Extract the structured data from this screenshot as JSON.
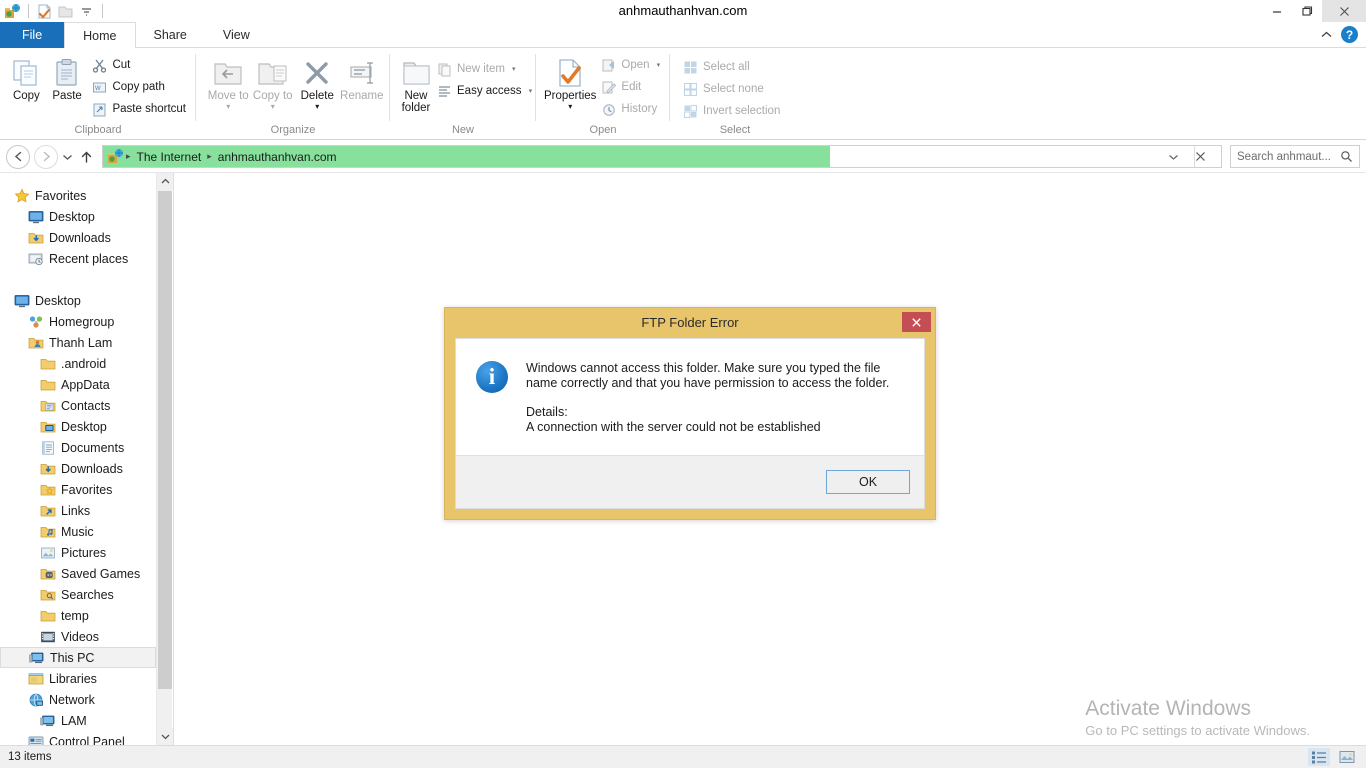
{
  "window": {
    "title": "anhmauthanhvan.com",
    "quick_access": [
      "ftp-folder-icon",
      "properties-icon",
      "folder-icon",
      "customize-dropdown-icon"
    ],
    "controls": {
      "minimize": "–",
      "maximize": "❐",
      "close": "✕"
    }
  },
  "ribbon": {
    "tabs": [
      {
        "label": "File",
        "state": "file"
      },
      {
        "label": "Home",
        "state": "active"
      },
      {
        "label": "Share",
        "state": "normal"
      },
      {
        "label": "View",
        "state": "normal"
      }
    ],
    "collapse_icon": "chevron-up-icon",
    "help_icon": "help-icon",
    "help_glyph": "?",
    "groups": [
      {
        "label": "Clipboard",
        "big": [
          {
            "label": "Copy",
            "icon": "copy-icon",
            "disabled": false
          },
          {
            "label": "Paste",
            "icon": "paste-icon",
            "disabled": false
          }
        ],
        "small": [
          {
            "label": "Cut",
            "icon": "cut-icon",
            "disabled": false
          },
          {
            "label": "Copy path",
            "icon": "copy-path-icon",
            "disabled": false
          },
          {
            "label": "Paste shortcut",
            "icon": "paste-shortcut-icon",
            "disabled": false
          }
        ]
      },
      {
        "label": "Organize",
        "big": [
          {
            "label": "Move to",
            "icon": "move-to-icon",
            "disabled": true,
            "dropdown": true
          },
          {
            "label": "Copy to",
            "icon": "copy-to-icon",
            "disabled": true,
            "dropdown": true
          },
          {
            "label": "Delete",
            "icon": "delete-icon",
            "disabled": false,
            "dropdown": true
          },
          {
            "label": "Rename",
            "icon": "rename-icon",
            "disabled": true
          }
        ],
        "small": []
      },
      {
        "label": "New",
        "big": [
          {
            "label": "New folder",
            "icon": "new-folder-icon",
            "disabled": false
          }
        ],
        "small": [
          {
            "label": "New item",
            "icon": "new-item-icon",
            "disabled": true,
            "dropdown": true
          },
          {
            "label": "Easy access",
            "icon": "easy-access-icon",
            "disabled": false,
            "dropdown": true
          }
        ]
      },
      {
        "label": "Open",
        "big": [
          {
            "label": "Properties",
            "icon": "properties-icon",
            "disabled": false,
            "dropdown": true
          }
        ],
        "small": [
          {
            "label": "Open",
            "icon": "open-icon",
            "disabled": true,
            "dropdown": true
          },
          {
            "label": "Edit",
            "icon": "edit-icon",
            "disabled": true
          },
          {
            "label": "History",
            "icon": "history-icon",
            "disabled": true
          }
        ]
      },
      {
        "label": "Select",
        "big": [],
        "small": [
          {
            "label": "Select all",
            "icon": "select-all-icon",
            "disabled": true
          },
          {
            "label": "Select none",
            "icon": "select-none-icon",
            "disabled": true
          },
          {
            "label": "Invert selection",
            "icon": "invert-selection-icon",
            "disabled": true
          }
        ]
      }
    ]
  },
  "addressbar": {
    "back_glyph": "←",
    "forward_glyph": "→",
    "recent_glyph": "▾",
    "up_glyph": "↑",
    "location_icon": "internet-ftp-icon",
    "breadcrumbs": [
      "The Internet",
      "anhmauthanhvan.com"
    ],
    "separator": "▸",
    "dropdown_glyph": "∨",
    "stop_glyph": "✕",
    "loading_progress_percent": 61,
    "progress_color": "#87e09b"
  },
  "search": {
    "placeholder": "Search anhmaut...",
    "icon": "search-icon"
  },
  "navpane": {
    "items": [
      {
        "label": "Favorites",
        "icon": "star-icon",
        "indent": 0,
        "selected": false
      },
      {
        "label": "Desktop",
        "icon": "monitor-icon",
        "indent": 1,
        "selected": false
      },
      {
        "label": "Downloads",
        "icon": "downloads-folder-icon",
        "indent": 1,
        "selected": false
      },
      {
        "label": "Recent places",
        "icon": "recent-places-icon",
        "indent": 1,
        "selected": false
      },
      {
        "label": "",
        "icon": "spacer",
        "indent": 0,
        "selected": false
      },
      {
        "label": "Desktop",
        "icon": "monitor-icon",
        "indent": 0,
        "selected": false
      },
      {
        "label": "Homegroup",
        "icon": "homegroup-icon",
        "indent": 1,
        "selected": false
      },
      {
        "label": "Thanh Lam",
        "icon": "user-folder-icon",
        "indent": 1,
        "selected": false
      },
      {
        "label": ".android",
        "icon": "folder-icon",
        "indent": 2,
        "selected": false
      },
      {
        "label": "AppData",
        "icon": "folder-icon",
        "indent": 2,
        "selected": false
      },
      {
        "label": "Contacts",
        "icon": "contacts-folder-icon",
        "indent": 2,
        "selected": false
      },
      {
        "label": "Desktop",
        "icon": "desktop-folder-icon",
        "indent": 2,
        "selected": false
      },
      {
        "label": "Documents",
        "icon": "documents-folder-icon",
        "indent": 2,
        "selected": false
      },
      {
        "label": "Downloads",
        "icon": "downloads-folder-icon",
        "indent": 2,
        "selected": false
      },
      {
        "label": "Favorites",
        "icon": "favorites-folder-icon",
        "indent": 2,
        "selected": false
      },
      {
        "label": "Links",
        "icon": "links-folder-icon",
        "indent": 2,
        "selected": false
      },
      {
        "label": "Music",
        "icon": "music-folder-icon",
        "indent": 2,
        "selected": false
      },
      {
        "label": "Pictures",
        "icon": "pictures-folder-icon",
        "indent": 2,
        "selected": false
      },
      {
        "label": "Saved Games",
        "icon": "saved-games-folder-icon",
        "indent": 2,
        "selected": false
      },
      {
        "label": "Searches",
        "icon": "searches-folder-icon",
        "indent": 2,
        "selected": false
      },
      {
        "label": "temp",
        "icon": "folder-icon",
        "indent": 2,
        "selected": false
      },
      {
        "label": "Videos",
        "icon": "videos-folder-icon",
        "indent": 2,
        "selected": false
      },
      {
        "label": "This PC",
        "icon": "this-pc-icon",
        "indent": 1,
        "selected": true
      },
      {
        "label": "Libraries",
        "icon": "libraries-icon",
        "indent": 1,
        "selected": false
      },
      {
        "label": "Network",
        "icon": "network-icon",
        "indent": 1,
        "selected": false
      },
      {
        "label": "LAM",
        "icon": "computer-icon",
        "indent": 2,
        "selected": false
      },
      {
        "label": "Control Panel",
        "icon": "control-panel-icon",
        "indent": 1,
        "selected": false
      }
    ]
  },
  "statusbar": {
    "item_count": "13 items",
    "views": [
      {
        "name": "details-view-button",
        "icon": "details-view-icon",
        "active": true
      },
      {
        "name": "large-icons-view-button",
        "icon": "large-icons-view-icon",
        "active": false
      }
    ]
  },
  "watermark": {
    "line1": "Activate Windows",
    "line2": "Go to PC settings to activate Windows."
  },
  "dialog": {
    "title": "FTP Folder Error",
    "close_glyph": "✕",
    "icon": "info-icon",
    "icon_glyph": "i",
    "message": "Windows cannot access this folder. Make sure you typed the file name correctly and that you have permission to access the folder.",
    "details_label": "Details:",
    "details_text": "A connection with the server could not be established",
    "ok_label": "OK",
    "frame_color": "#e8c46a",
    "close_color": "#c34f55"
  }
}
